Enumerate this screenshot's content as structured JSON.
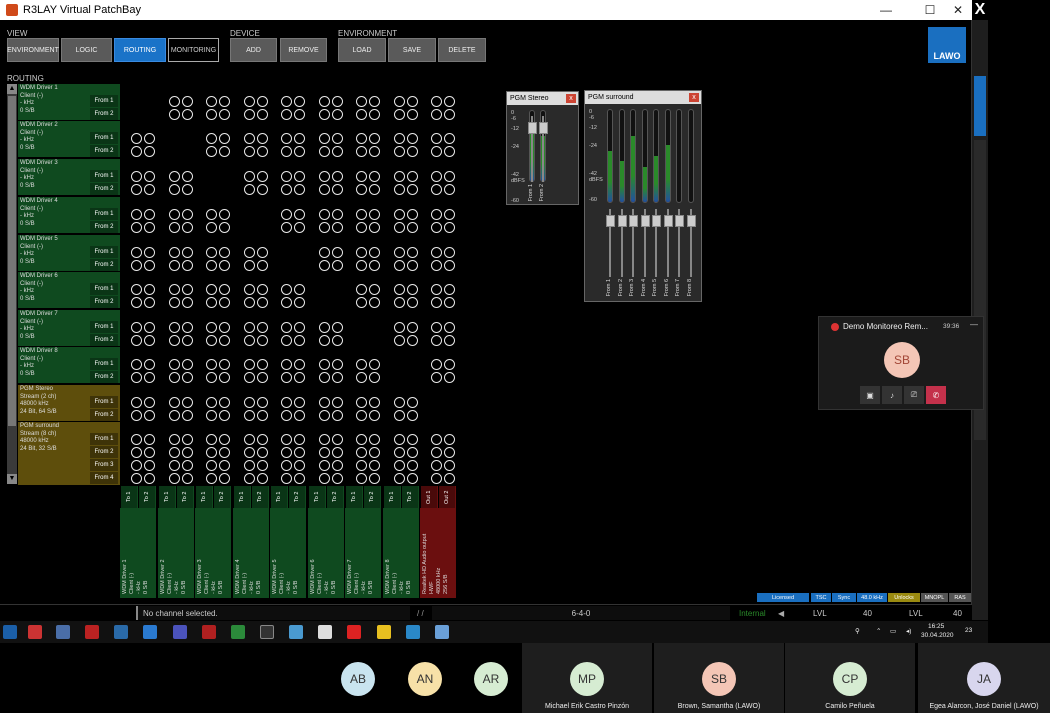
{
  "window": {
    "title": "R3LAY Virtual PatchBay",
    "min": "—",
    "max": "☐",
    "close": "✕"
  },
  "overlay_x": "X",
  "toolbar": {
    "view_label": "VIEW",
    "device_label": "DEVICE",
    "environment_label": "ENVIRONMENT",
    "view_buttons": [
      "ENVIRONMENT",
      "LOGIC",
      "ROUTING",
      "MONITORING"
    ],
    "device_buttons": [
      "ADD",
      "REMOVE"
    ],
    "environment_buttons": [
      "LOAD",
      "SAVE",
      "DELETE"
    ],
    "logo": "LAWO"
  },
  "routing_label": "ROUTING",
  "sources": [
    {
      "name": "WDM Driver 1",
      "l2": "Client (-)",
      "l3": "- kHz",
      "l4": "0 S/B",
      "ports": [
        "From 1",
        "From 2"
      ]
    },
    {
      "name": "WDM Driver 2",
      "l2": "Client (-)",
      "l3": "- kHz",
      "l4": "0 S/B",
      "ports": [
        "From 1",
        "From 2"
      ]
    },
    {
      "name": "WDM Driver 3",
      "l2": "Client (-)",
      "l3": "- kHz",
      "l4": "0 S/B",
      "ports": [
        "From 1",
        "From 2"
      ]
    },
    {
      "name": "WDM Driver 4",
      "l2": "Client (-)",
      "l3": "- kHz",
      "l4": "0 S/B",
      "ports": [
        "From 1",
        "From 2"
      ]
    },
    {
      "name": "WDM Driver 5",
      "l2": "Client (-)",
      "l3": "- kHz",
      "l4": "0 S/B",
      "ports": [
        "From 1",
        "From 2"
      ]
    },
    {
      "name": "WDM Driver 6",
      "l2": "Client (-)",
      "l3": "- kHz",
      "l4": "0 S/B",
      "ports": [
        "From 1",
        "From 2"
      ]
    },
    {
      "name": "WDM Driver 7",
      "l2": "Client (-)",
      "l3": "- kHz",
      "l4": "0 S/B",
      "ports": [
        "From 1",
        "From 2"
      ]
    },
    {
      "name": "WDM Driver 8",
      "l2": "Client (-)",
      "l3": "- kHz",
      "l4": "0 S/B",
      "ports": [
        "From 1",
        "From 2"
      ]
    },
    {
      "name": "PGM Stereo",
      "l2": "Stream (2 ch)",
      "l3": "48000 kHz",
      "l4": "24 Bit, 64 S/B",
      "ports": [
        "From 1",
        "From 2"
      ]
    },
    {
      "name": "PGM surround",
      "l2": "Stream (8 ch)",
      "l3": "48000 kHz",
      "l4": "24 Bit, 32 S/B",
      "ports": [
        "From 1",
        "From 2",
        "From 3",
        "From 4"
      ]
    }
  ],
  "destinations": [
    {
      "label": "WDM Driver 1\nClient (-)\n- kHz\n0 S/B",
      "ports": [
        "To 1",
        "To 2"
      ]
    },
    {
      "label": "WDM Driver 2\nClient (-)\n- kHz\n0 S/B",
      "ports": [
        "To 1",
        "To 2"
      ]
    },
    {
      "label": "WDM Driver 3\nClient (-)\n- kHz\n0 S/B",
      "ports": [
        "To 1",
        "To 2"
      ]
    },
    {
      "label": "WDM Driver 4\nClient (-)\n- kHz\n0 S/B",
      "ports": [
        "To 1",
        "To 2"
      ]
    },
    {
      "label": "WDM Driver 5\nClient (-)\n- kHz\n0 S/B",
      "ports": [
        "To 1",
        "To 2"
      ]
    },
    {
      "label": "WDM Driver 6\nClient (-)\n- kHz\n0 S/B",
      "ports": [
        "To 1",
        "To 2"
      ]
    },
    {
      "label": "WDM Driver 7\nClient (-)\n- kHz\n0 S/B",
      "ports": [
        "To 1",
        "To 2"
      ]
    },
    {
      "label": "WDM Driver 8\nClient (-)\n- kHz\n0 S/B",
      "ports": [
        "To 1",
        "To 2"
      ]
    },
    {
      "label": "Realtek HD Audio output\nHWF\n48000 kHz\n256 S/B",
      "ports": [
        "Out 1",
        "Out 2"
      ]
    }
  ],
  "routed_cells": [
    [
      8,
      8,
      0
    ],
    [
      8,
      8,
      1
    ]
  ],
  "meters": {
    "stereo": {
      "title": "PGM Stereo",
      "close": "x",
      "scale": [
        "0",
        "-6",
        "-12",
        "-24",
        "-42",
        "dBFS",
        "-60"
      ],
      "channels": [
        "From 1",
        "From 2"
      ],
      "levels": [
        0.72,
        0.65
      ]
    },
    "surround": {
      "title": "PGM surround",
      "close": "x",
      "scale": [
        "0",
        "-6",
        "-12",
        "-24",
        "-42",
        "dBFS",
        "-60"
      ],
      "channels": [
        "From 1",
        "From 2",
        "From 3",
        "From 4",
        "From 5",
        "From 6",
        "From 7",
        "From 8"
      ],
      "levels": [
        0.55,
        0.45,
        0.72,
        0.38,
        0.5,
        0.62,
        0,
        0
      ]
    }
  },
  "license_tags": [
    "Licensed",
    "TSC",
    "Sync",
    "48.0 kHz",
    "Unlocks",
    "MNOPL",
    "RAS"
  ],
  "statusbar": {
    "message": "No channel selected.",
    "sep": "/ /",
    "center": "6-4-0",
    "internal": "Internal",
    "lvl1_label": "LVL",
    "lvl1_value": "40",
    "lvl2_label": "LVL",
    "lvl2_value": "40"
  },
  "teams": {
    "title": "Demo Monitoreo Rem...",
    "time": "39:36",
    "min": "—",
    "initials": "SB"
  },
  "taskbar": {
    "time": "16:25",
    "date": "30.04.2020",
    "notif": "23"
  },
  "participants": [
    {
      "initials": "AB",
      "name": ""
    },
    {
      "initials": "AN",
      "name": ""
    },
    {
      "initials": "AR",
      "name": ""
    },
    {
      "initials": "MP",
      "name": "Michael Erik Castro Pinzón"
    },
    {
      "initials": "SB",
      "name": "Brown, Samantha (LAWO)"
    },
    {
      "initials": "CP",
      "name": "Camilo Peñuela"
    },
    {
      "initials": "JA",
      "name": "Egea Alarcon, José Daniel (LAWO)"
    }
  ],
  "colors": {
    "source_green": "#0f4a1f",
    "source_gold": "#5e4e0c",
    "port_green": "#0a3516",
    "port_gold": "#3e3308",
    "active_blue": "#1a73c8",
    "route_on": "#2bb52b",
    "hw_out": "#6b0f0f"
  }
}
